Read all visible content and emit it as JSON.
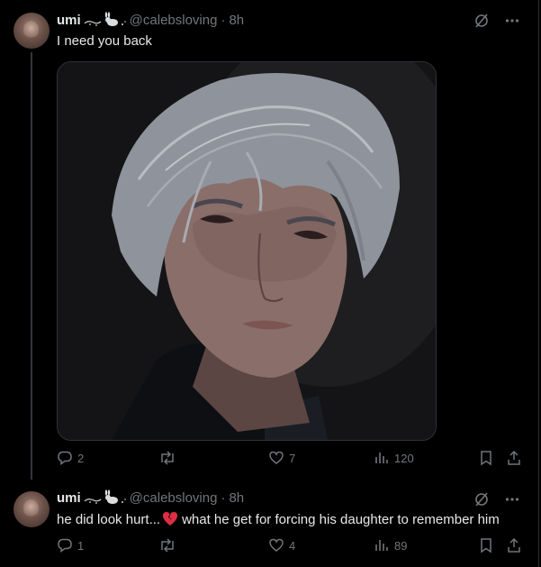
{
  "posts": [
    {
      "display_name": "umi",
      "handle": "@calebsloving",
      "separator": "·",
      "time": "8h",
      "text": "I need you back",
      "stats": {
        "replies": "2",
        "reposts": "",
        "likes": "7",
        "views": "120"
      }
    },
    {
      "display_name": "umi",
      "handle": "@calebsloving",
      "separator": "·",
      "time": "8h",
      "text_before_emoji": "he did look hurt...",
      "text_after_emoji": "what he get for forcing his daughter to remember him",
      "stats": {
        "replies": "1",
        "reposts": "",
        "likes": "4",
        "views": "89"
      }
    }
  ],
  "icons": {
    "grok": "grok-icon",
    "more": "more-icon",
    "reply": "reply-icon",
    "repost": "repost-icon",
    "like": "like-icon",
    "views": "views-icon",
    "bookmark": "bookmark-icon",
    "share": "share-icon",
    "emoji": "broken-heart-emoji"
  },
  "colors": {
    "background": "#000000",
    "text": "#e7e9ea",
    "muted": "#71767b",
    "border": "#2f3336",
    "broken_heart": "#dd2e44"
  }
}
